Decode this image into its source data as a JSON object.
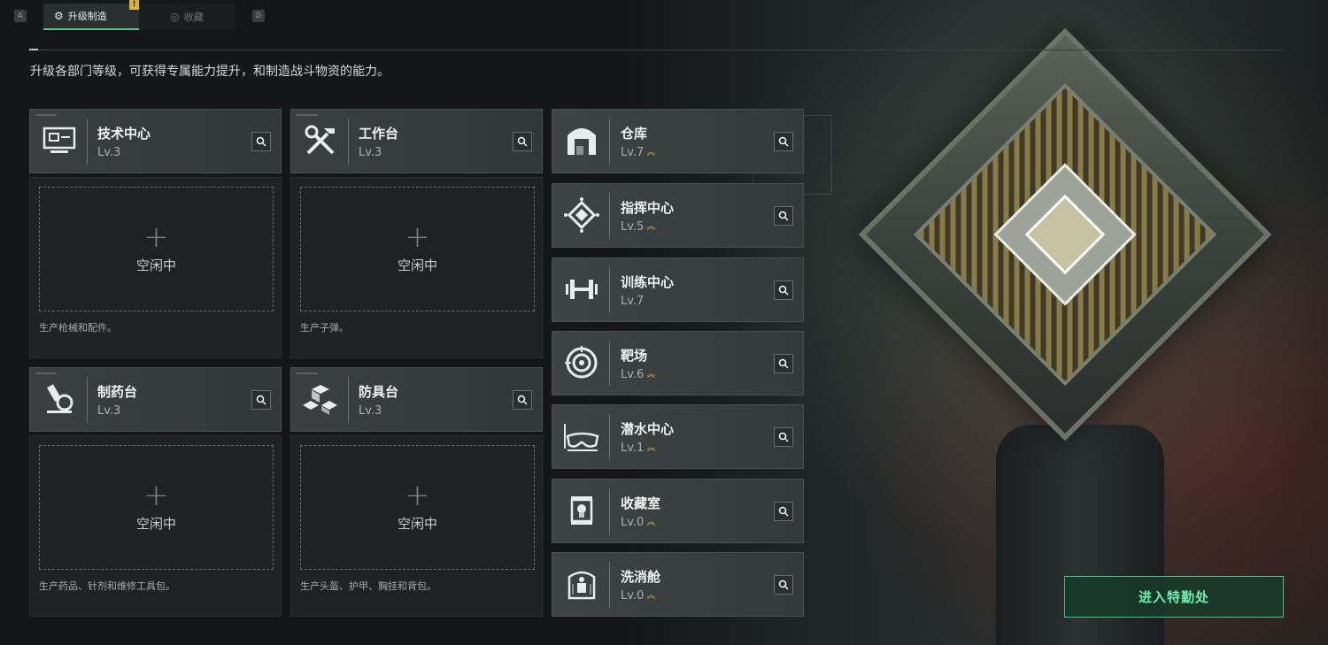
{
  "tabs": {
    "key_left": "A",
    "key_right": "D",
    "active_label": "升级制造",
    "inactive_label": "收藏",
    "badge": "!"
  },
  "description": "升级各部门等级，可获得专属能力提升，和制造战斗物资的能力。",
  "workshops": [
    {
      "name": "技术中心",
      "level": "Lv.3",
      "icon": "computer-icon",
      "slot_status": "空闲中",
      "slot_plus": "+",
      "desc": "生产枪械和配件。"
    },
    {
      "name": "工作台",
      "level": "Lv.3",
      "icon": "tools-icon",
      "slot_status": "空闲中",
      "slot_plus": "+",
      "desc": "生产子弹。"
    },
    {
      "name": "制药台",
      "level": "Lv.3",
      "icon": "microscope-icon",
      "slot_status": "空闲中",
      "slot_plus": "+",
      "desc": "生产药品、针剂和维修工具包。"
    },
    {
      "name": "防具台",
      "level": "Lv.3",
      "icon": "cubes-icon",
      "slot_status": "空闲中",
      "slot_plus": "+",
      "desc": "生产头盔、护甲、胸挂和背包。"
    }
  ],
  "departments": [
    {
      "name": "仓库",
      "level": "Lv.7",
      "icon": "warehouse-icon",
      "upgradable": true
    },
    {
      "name": "指挥中心",
      "level": "Lv.5",
      "icon": "command-icon",
      "upgradable": true
    },
    {
      "name": "训练中心",
      "level": "Lv.7",
      "icon": "dumbbell-icon",
      "upgradable": false
    },
    {
      "name": "靶场",
      "level": "Lv.6",
      "icon": "target-icon",
      "upgradable": true
    },
    {
      "name": "潜水中心",
      "level": "Lv.1",
      "icon": "diving-mask-icon",
      "upgradable": true
    },
    {
      "name": "收藏室",
      "level": "Lv.0",
      "icon": "display-case-icon",
      "upgradable": true
    },
    {
      "name": "洗消舱",
      "level": "Lv.0",
      "icon": "decontamination-icon",
      "upgradable": true
    }
  ],
  "enter_button": "进入特勤处",
  "colors": {
    "accent": "#4bbf83",
    "upgrade": "#d6b35a",
    "background": "#141617"
  }
}
